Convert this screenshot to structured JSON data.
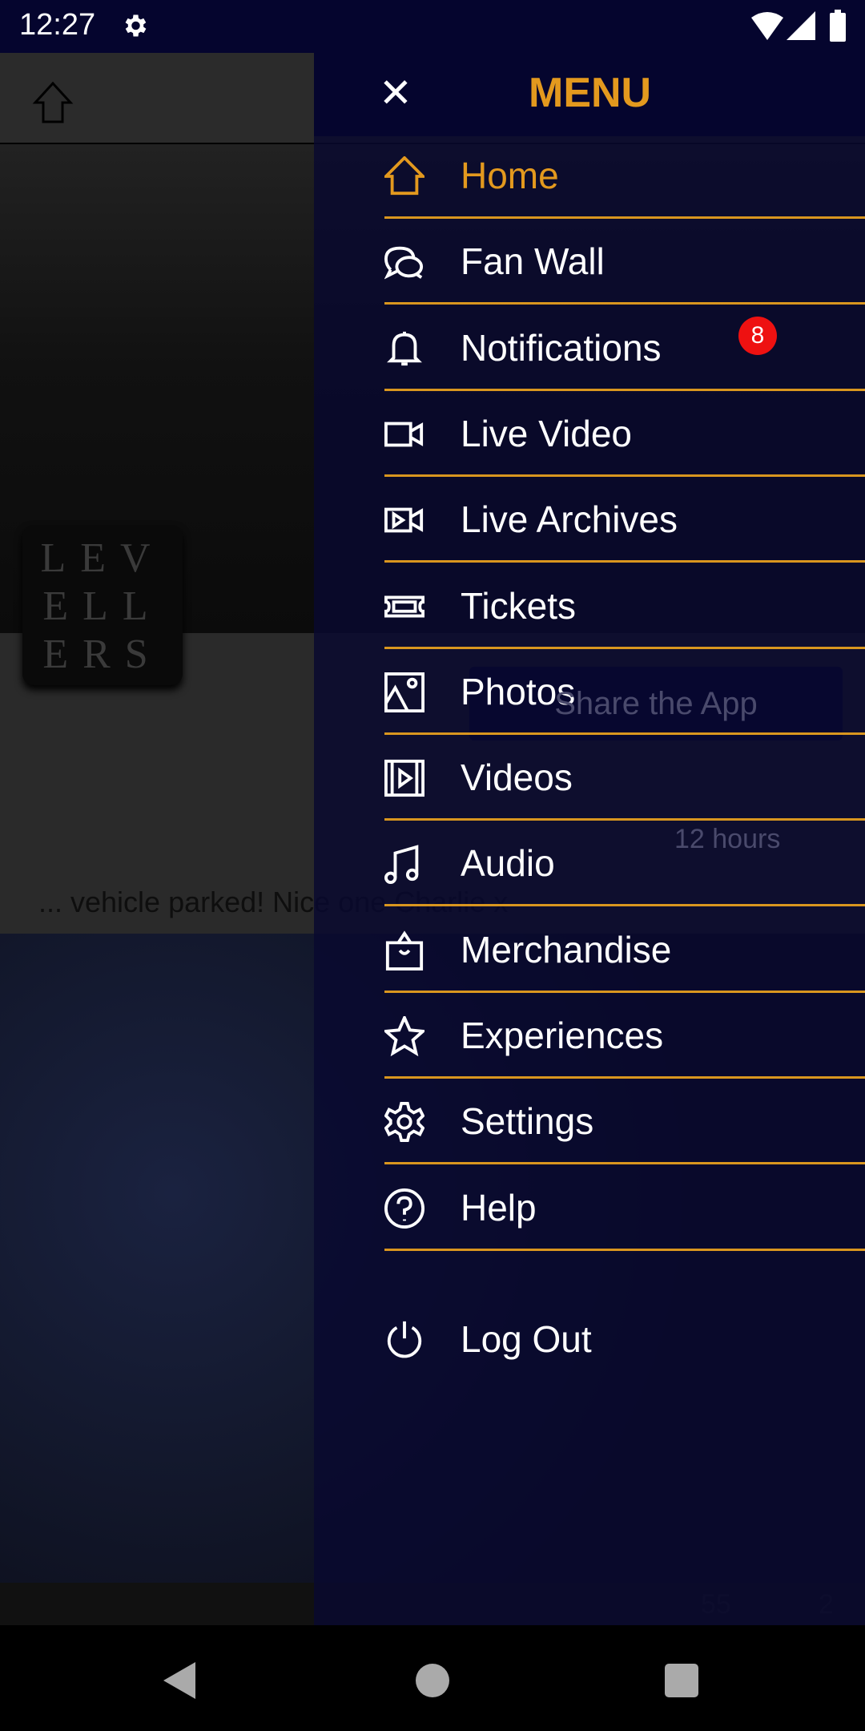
{
  "status_bar": {
    "time": "12:27",
    "icons": [
      "gear-icon",
      "wifi-icon",
      "signal-icon",
      "battery-icon"
    ]
  },
  "background": {
    "logo_text": "LEV ELL ERS",
    "share_button": "Share the App",
    "post_time": "12 hours",
    "post_text": "... vehicle parked! Nice one Charlie x",
    "likes": "55",
    "comments": "2"
  },
  "menu": {
    "title": "MENU",
    "accent": "#e3991e",
    "items": [
      {
        "label": "Home",
        "icon": "home",
        "active": true
      },
      {
        "label": "Fan Wall",
        "icon": "chat"
      },
      {
        "label": "Notifications",
        "icon": "bell",
        "badge": "8"
      },
      {
        "label": "Live Video",
        "icon": "video-camera"
      },
      {
        "label": "Live Archives",
        "icon": "archive-video"
      },
      {
        "label": "Tickets",
        "icon": "ticket"
      },
      {
        "label": "Photos",
        "icon": "image"
      },
      {
        "label": "Videos",
        "icon": "film"
      },
      {
        "label": "Audio",
        "icon": "music-note"
      },
      {
        "label": "Merchandise",
        "icon": "shopping-bag"
      },
      {
        "label": "Experiences",
        "icon": "star"
      },
      {
        "label": "Settings",
        "icon": "gear"
      },
      {
        "label": "Help",
        "icon": "help-circle"
      }
    ],
    "logout": {
      "label": "Log Out",
      "icon": "power"
    }
  }
}
